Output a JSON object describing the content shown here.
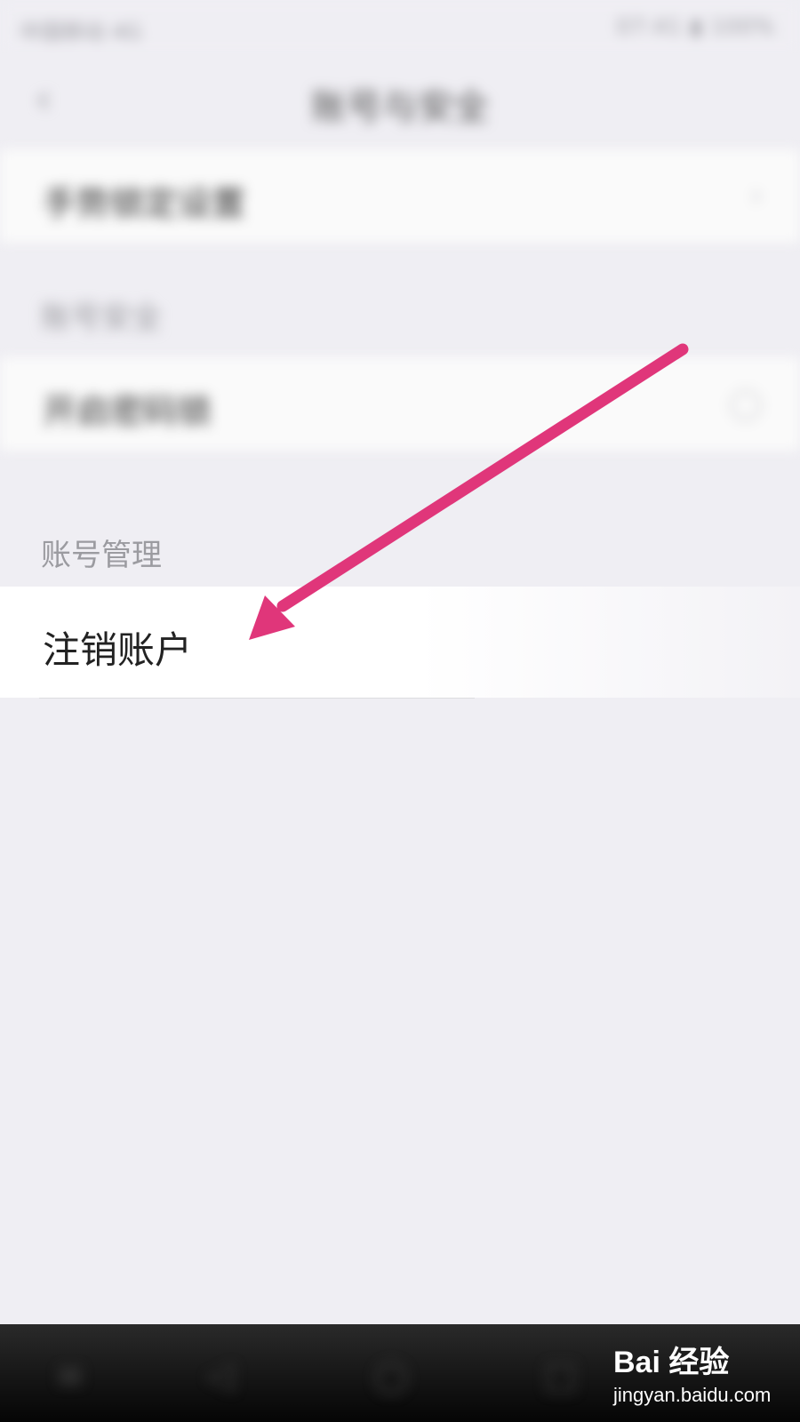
{
  "status_bar": {
    "left": "中国移动 4G",
    "right": "07:41 ▮ 100%"
  },
  "navbar": {
    "title": "账号与安全"
  },
  "rows": [
    {
      "label": "手势锁定设置"
    },
    {
      "label": "开启密码锁"
    }
  ],
  "sections": [
    {
      "label": "账号安全"
    },
    {
      "label": "账号管理"
    }
  ],
  "highlight_row": {
    "label": "注销账户"
  },
  "annotation": {
    "arrow_color": "#e0367a"
  },
  "watermark": {
    "brand": "Bai 经验",
    "url": "jingyan.baidu.com"
  },
  "system_nav": {
    "back": "◁",
    "home": "○",
    "recent": "□",
    "menu": "≡"
  }
}
